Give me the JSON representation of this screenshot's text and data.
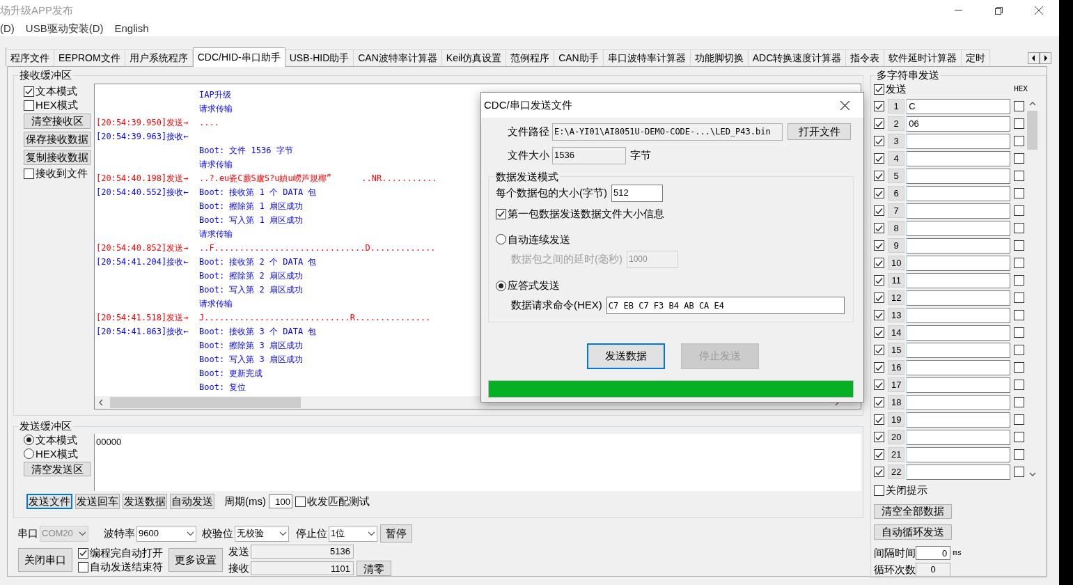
{
  "window": {
    "title": "场升级APP发布"
  },
  "menu": [
    "(D)",
    "USB驱动安装(D)",
    "English"
  ],
  "tabs": [
    {
      "label": "程序文件",
      "selected": false
    },
    {
      "label": "EEPROM文件",
      "selected": false
    },
    {
      "label": "用户系统程序",
      "selected": false
    },
    {
      "label": "CDC/HID-串口助手",
      "selected": true
    },
    {
      "label": "USB-HID助手",
      "selected": false
    },
    {
      "label": "CAN波特率计算器",
      "selected": false
    },
    {
      "label": "Keil仿真设置",
      "selected": false
    },
    {
      "label": "范例程序",
      "selected": false
    },
    {
      "label": "CAN助手",
      "selected": false
    },
    {
      "label": "串口波特率计算器",
      "selected": false
    },
    {
      "label": "功能脚切换",
      "selected": false
    },
    {
      "label": "ADC转换速度计算器",
      "selected": false
    },
    {
      "label": "指令表",
      "selected": false
    },
    {
      "label": "软件延时计算器",
      "selected": false
    },
    {
      "label": "定时",
      "selected": false
    }
  ],
  "receive": {
    "title": "接收缓冲区",
    "options": [
      {
        "kind": "checkbox",
        "label": "文本模式",
        "checked": true
      },
      {
        "kind": "checkbox",
        "label": "HEX模式",
        "checked": false
      },
      {
        "kind": "button",
        "label": "清空接收区"
      },
      {
        "kind": "button",
        "label": "保存接收数据"
      },
      {
        "kind": "button",
        "label": "复制接收数据"
      },
      {
        "kind": "checkbox",
        "label": "接收到文件",
        "checked": false
      }
    ],
    "log": [
      {
        "kind": "cont",
        "text": "IAP升级"
      },
      {
        "kind": "cont",
        "text": "请求传输"
      },
      {
        "kind": "send",
        "stamp": "[20:54:39.950]发送→",
        "text": "...."
      },
      {
        "kind": "recv",
        "stamp": "[20:54:39.963]接收←"
      },
      {
        "kind": "cont",
        "text": "Boot: 文件 1536 字节"
      },
      {
        "kind": "cont",
        "text": "请求传输"
      },
      {
        "kind": "send",
        "stamp": "[20:54:40.198]发送→",
        "text": "..?.eu瓷C蕨S廬S?u媜u嶗芦規椰”      ..NR..........."
      },
      {
        "kind": "recv",
        "stamp": "[20:54:40.552]接收←",
        "text": "Boot: 接收第 1 个 DATA 包"
      },
      {
        "kind": "cont",
        "text": "Boot: 擦除第 1 扇区成功"
      },
      {
        "kind": "cont",
        "text": "Boot: 写入第 1 扇区成功"
      },
      {
        "kind": "cont",
        "text": "请求传输"
      },
      {
        "kind": "send",
        "stamp": "[20:54:40.852]发送→",
        "text": "..F..............................D............."
      },
      {
        "kind": "recv",
        "stamp": "[20:54:41.204]接收←",
        "text": "Boot: 接收第 2 个 DATA 包"
      },
      {
        "kind": "cont",
        "text": "Boot: 擦除第 2 扇区成功"
      },
      {
        "kind": "cont",
        "text": "Boot: 写入第 2 扇区成功"
      },
      {
        "kind": "cont",
        "text": "请求传输"
      },
      {
        "kind": "send",
        "stamp": "[20:54:41.518]发送→",
        "text": "J.............................R..............."
      },
      {
        "kind": "recv",
        "stamp": "[20:54:41.863]接收←",
        "text": "Boot: 接收第 3 个 DATA 包"
      },
      {
        "kind": "cont",
        "text": "Boot: 擦除第 3 扇区成功"
      },
      {
        "kind": "cont",
        "text": "Boot: 写入第 3 扇区成功"
      },
      {
        "kind": "cont",
        "text": "Boot: 更新完成"
      },
      {
        "kind": "cont",
        "text": "Boot: 复位"
      }
    ]
  },
  "send": {
    "title": "发送缓冲区",
    "modes": [
      {
        "label": "文本模式",
        "selected": true
      },
      {
        "label": "HEX模式",
        "selected": false
      }
    ],
    "clear_button": "清空发送区",
    "text": "00000",
    "buttons": [
      {
        "label": "发送文件",
        "focused": true
      },
      {
        "label": "发送回车",
        "focused": false
      },
      {
        "label": "发送数据",
        "focused": false
      },
      {
        "label": "自动发送",
        "focused": false
      }
    ],
    "period_label": "周期(ms)",
    "period": "100",
    "match_test": {
      "label": "收发匹配测试",
      "checked": false
    }
  },
  "port": {
    "selects": [
      {
        "label": "串口",
        "value": "COM20",
        "disabled": true
      },
      {
        "label": "波特率",
        "value": "9600",
        "disabled": false
      },
      {
        "label": "校验位",
        "value": "无校验",
        "disabled": false
      },
      {
        "label": "停止位",
        "value": "1位",
        "disabled": false
      }
    ],
    "pause_button": "暂停",
    "close_button": "关闭串口",
    "checks": [
      {
        "label": "编程完自动打开",
        "checked": true
      },
      {
        "label": "自动发送结束符",
        "checked": false
      }
    ],
    "more_button": "更多设置",
    "counters": [
      {
        "label": "发送",
        "value": "5136"
      },
      {
        "label": "接收",
        "value": "1101"
      }
    ],
    "reset_button": "清零"
  },
  "multi_send": {
    "title": "多字符串发送",
    "send_all": {
      "label": "发送",
      "checked": true
    },
    "hex_label": "HEX",
    "rows": [
      {
        "checked": true,
        "number": "1",
        "value": "C",
        "hex": false
      },
      {
        "checked": true,
        "number": "2",
        "value": "06",
        "hex": false
      },
      {
        "checked": true,
        "number": "3",
        "hex": false
      },
      {
        "checked": true,
        "number": "4",
        "hex": false
      },
      {
        "checked": true,
        "number": "5",
        "hex": false
      },
      {
        "checked": true,
        "number": "6",
        "hex": false
      },
      {
        "checked": true,
        "number": "7",
        "hex": false
      },
      {
        "checked": true,
        "number": "8",
        "hex": false
      },
      {
        "checked": true,
        "number": "9",
        "hex": false
      },
      {
        "checked": true,
        "number": "10",
        "hex": false
      },
      {
        "checked": true,
        "number": "11",
        "hex": false
      },
      {
        "checked": true,
        "number": "12",
        "hex": false
      },
      {
        "checked": true,
        "number": "13",
        "hex": false
      },
      {
        "checked": true,
        "number": "14",
        "hex": false
      },
      {
        "checked": true,
        "number": "15",
        "hex": false
      },
      {
        "checked": true,
        "number": "16",
        "hex": false
      },
      {
        "checked": true,
        "number": "17",
        "hex": false
      },
      {
        "checked": true,
        "number": "18",
        "hex": false
      },
      {
        "checked": true,
        "number": "19",
        "hex": false
      },
      {
        "checked": true,
        "number": "20",
        "hex": false
      },
      {
        "checked": true,
        "number": "21",
        "hex": false
      },
      {
        "checked": true,
        "number": "22",
        "hex": false
      }
    ],
    "close_hint": {
      "label": "关闭提示",
      "checked": false
    },
    "buttons": [
      "清空全部数据",
      "自动循环发送"
    ],
    "interval": {
      "label": "间隔时间",
      "value": "0",
      "unit": "ms"
    },
    "loops": {
      "label": "循环次数",
      "value": "0"
    }
  },
  "dialog": {
    "title": "CDC/串口发送文件",
    "path_label": "文件路径",
    "path": "E:\\A-YI01\\AI8051U-DEMO-CODE-...\\LED_P43.bin",
    "open_button": "打开文件",
    "size_label": "文件大小",
    "size": "1536",
    "size_unit": "字节",
    "mode_title": "数据发送模式",
    "packet_label": "每个数据包的大小(字节)",
    "packet": "512",
    "first_packet": {
      "label": "第一包数据发送数据文件大小信息",
      "checked": true
    },
    "modes": [
      {
        "label": "自动连续发送",
        "selected": false,
        "field_label": "数据包之间的延时(毫秒)",
        "field": "1000"
      },
      {
        "label": "应答式发送",
        "selected": true,
        "field_label": "数据请求命令(HEX)",
        "field": "C7 EB C7 F3 B4 AB CA E4"
      }
    ],
    "buttons": [
      {
        "label": "发送数据",
        "disabled": false
      },
      {
        "label": "停止发送",
        "disabled": true
      }
    ],
    "progress": {
      "level": 1
    }
  }
}
